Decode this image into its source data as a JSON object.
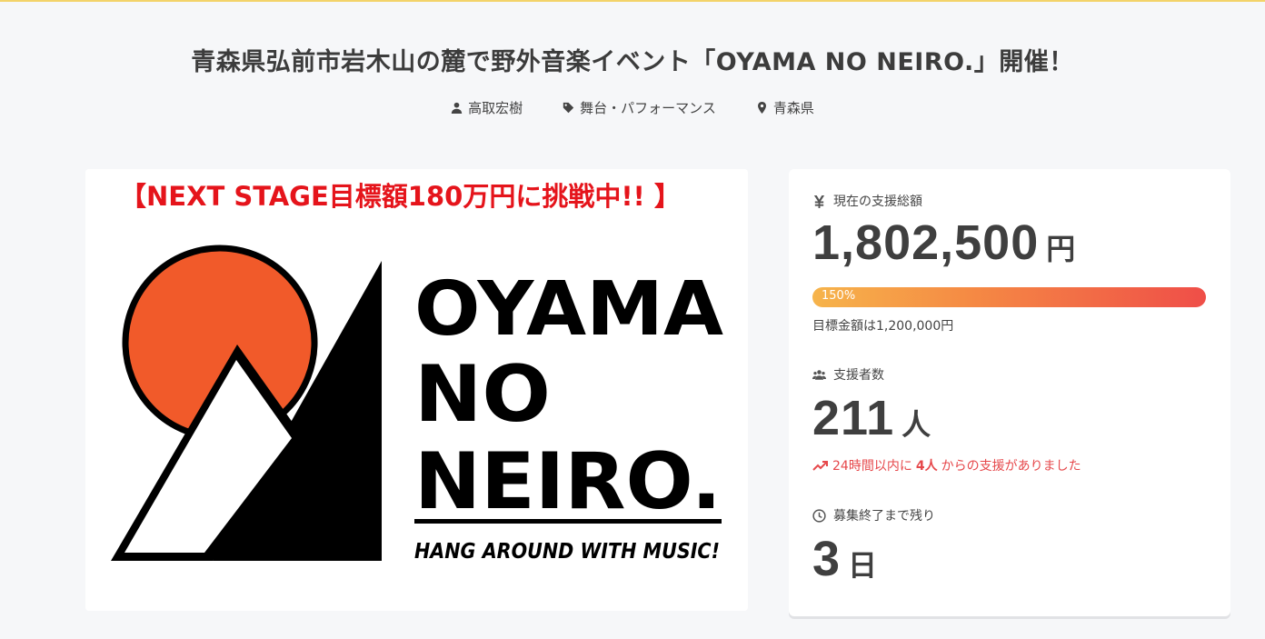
{
  "project": {
    "title": "青森県弘前市岩木山の麓で野外音楽イベント「OYAMA NO NEIRO.」開催！",
    "owner": "高取宏樹",
    "category": "舞台・パフォーマンス",
    "location": "青森県"
  },
  "hero": {
    "banner_text": "【NEXT STAGE目標額180万円に挑戦中!! 】",
    "logo_lines": [
      "OYAMA",
      "NO",
      "NEIRO."
    ],
    "tagline": "HANG AROUND WITH MUSIC!"
  },
  "stats": {
    "total": {
      "label": "現在の支援総額",
      "icon": "yen-icon",
      "value": "1,802,500",
      "unit": "円",
      "progress_label": "150%",
      "progress_percent": 150,
      "goal_text": "目標金額は1,200,000円"
    },
    "supporters": {
      "label": "支援者数",
      "icon": "users-icon",
      "value": "211",
      "unit": "人",
      "trend_prefix": "24時間以内に",
      "trend_count": "4人",
      "trend_suffix": "からの支援がありました"
    },
    "remaining": {
      "label": "募集終了まで残り",
      "icon": "clock-icon",
      "value": "3",
      "unit": "日"
    }
  },
  "colors": {
    "accent_orange": "#f15a2a",
    "progress_start": "#f6b44b",
    "progress_end": "#ef4e48",
    "trend_red": "#e6484b",
    "banner_red": "#e5141b"
  }
}
